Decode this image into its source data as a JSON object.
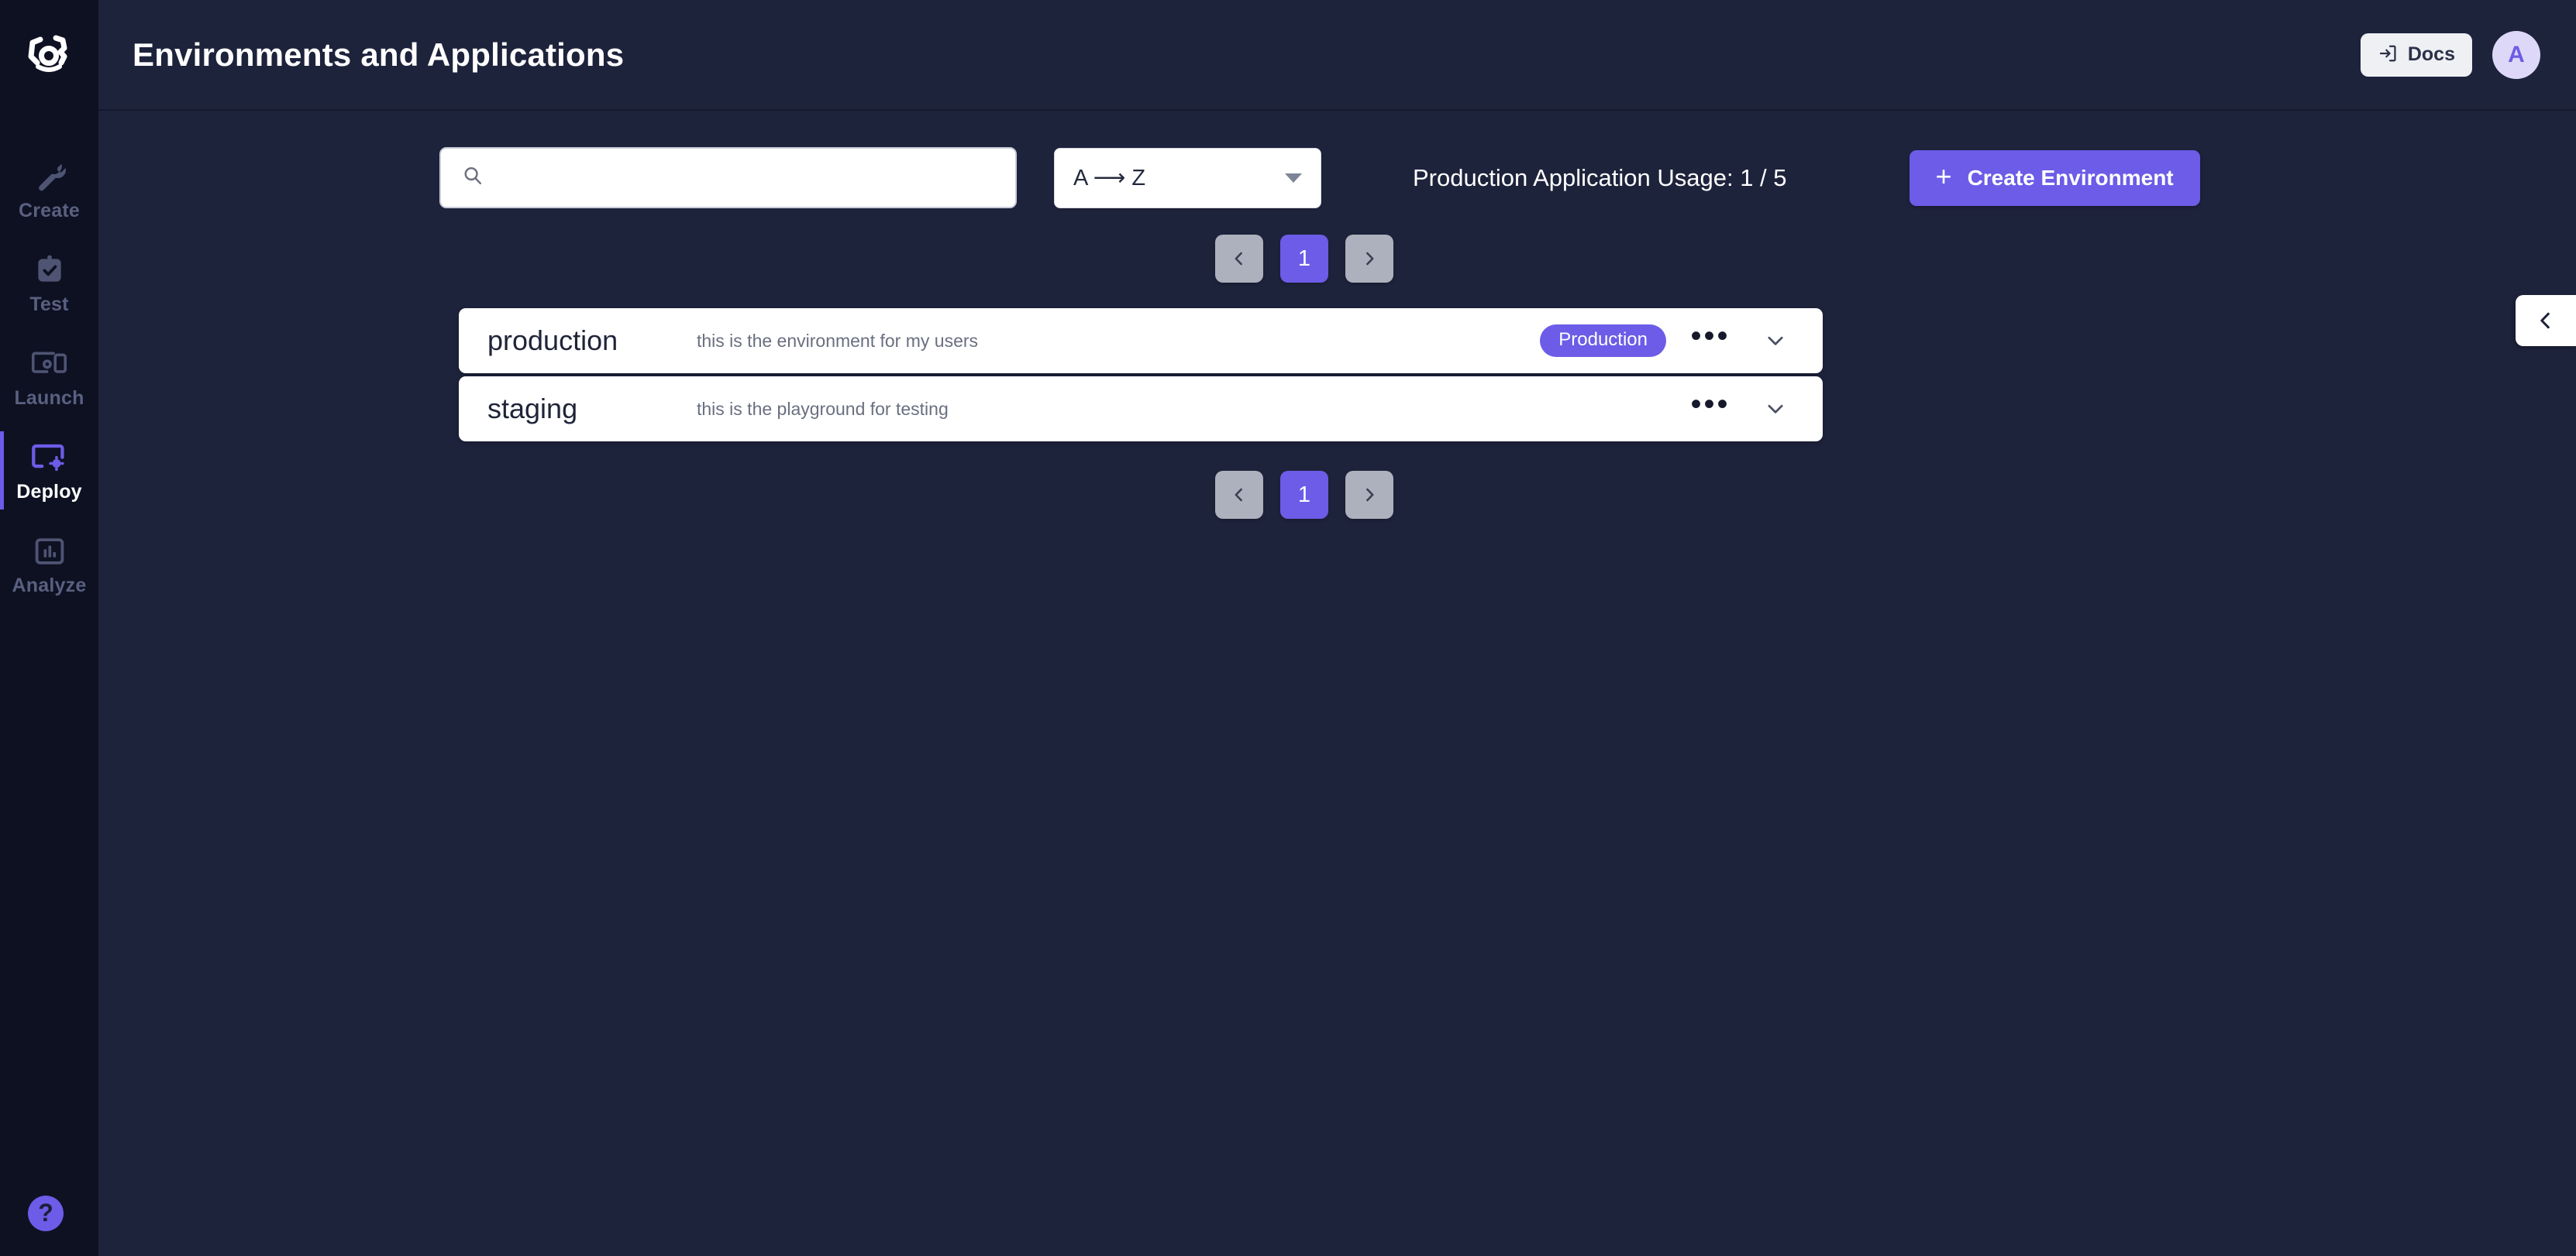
{
  "app": {
    "logo_icon": "bracket-eye-logo",
    "accent_color": "#6c5ce7",
    "sidebar_bg": "#0e1122",
    "content_bg": "#1e233c"
  },
  "sidebar": {
    "items": [
      {
        "label": "Create",
        "icon": "wrench-icon",
        "active": false
      },
      {
        "label": "Test",
        "icon": "clipboard-check-icon",
        "active": false
      },
      {
        "label": "Launch",
        "icon": "devices-icon",
        "active": false
      },
      {
        "label": "Deploy",
        "icon": "screen-gear-icon",
        "active": true
      },
      {
        "label": "Analyze",
        "icon": "bar-chart-icon",
        "active": false
      }
    ],
    "help": {
      "icon": "question-mark-icon",
      "label": "?"
    }
  },
  "header": {
    "title": "Environments and Applications",
    "docs_button": {
      "label": "Docs",
      "icon": "external-link-icon"
    },
    "avatar": {
      "initial": "A"
    }
  },
  "toolbar": {
    "search": {
      "value": "",
      "placeholder": "",
      "icon": "search-icon"
    },
    "sort": {
      "selected": "A ⟶ Z",
      "icon": "chevron-down-icon"
    },
    "usage": "Production Application Usage: 1 / 5",
    "create_button": {
      "label": "Create Environment",
      "icon": "plus-icon"
    }
  },
  "pagination": {
    "prev_icon": "chevron-left-icon",
    "next_icon": "chevron-right-icon",
    "pages": [
      "1"
    ],
    "current": "1"
  },
  "environments": [
    {
      "name": "production",
      "description": "this is the environment for my users",
      "badge": "Production",
      "menu_icon": "ellipsis-icon",
      "expand_icon": "chevron-down-icon"
    },
    {
      "name": "staging",
      "description": "this is the playground for testing",
      "badge": null,
      "menu_icon": "ellipsis-icon",
      "expand_icon": "chevron-down-icon"
    }
  ],
  "panel_toggle": {
    "icon": "chevron-left-icon"
  }
}
